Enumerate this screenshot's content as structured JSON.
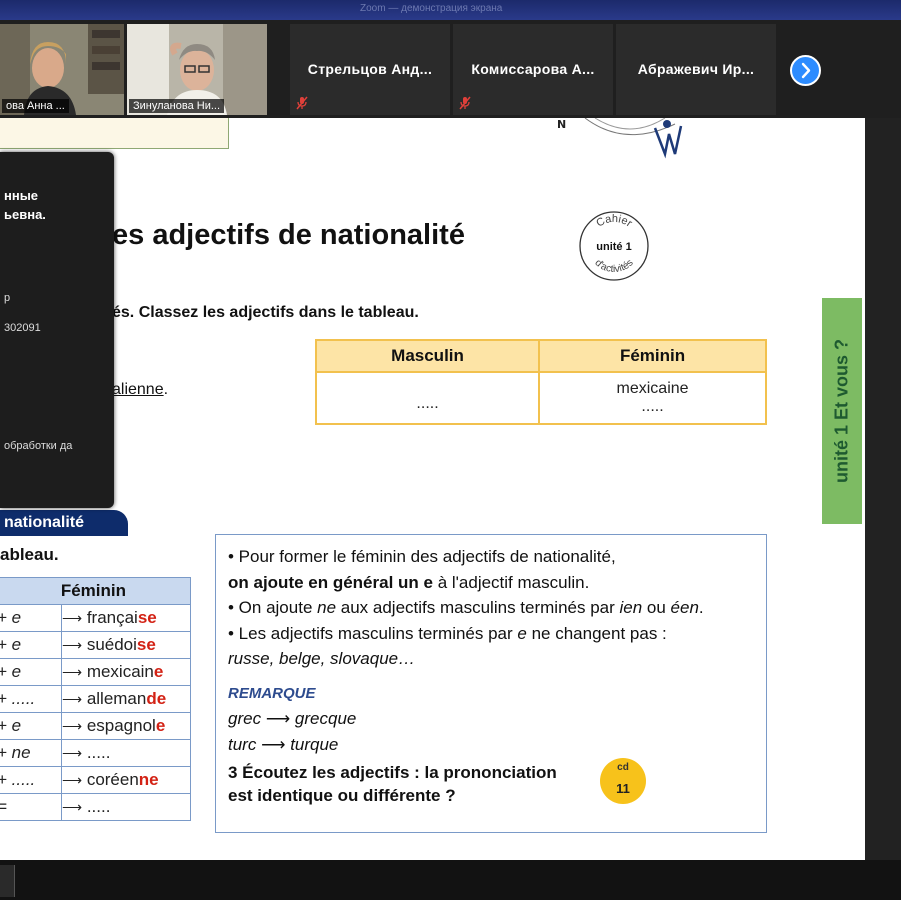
{
  "window": {
    "title": "Zoom — демонстрация экрана"
  },
  "participants": [
    {
      "label": "ова Анна ...",
      "type": "video",
      "active": true
    },
    {
      "label": "Зинуланова Ни...",
      "type": "video",
      "active": false
    },
    {
      "label": "Стрельцов Анд...",
      "type": "name",
      "muted": true
    },
    {
      "label": "Комиссарова А...",
      "type": "name",
      "muted": true
    },
    {
      "label": "Абражевич Ир...",
      "type": "name",
      "muted": false
    }
  ],
  "icons": {
    "next": "chevron-right-icon",
    "mic_off": "mic-off-icon"
  },
  "colors": {
    "zoom_blue": "#2d8cff",
    "active_outline": "#9fd03b",
    "table_orange": "#f2c14e",
    "banner_navy": "#0e2c6b",
    "highlight_red": "#d32215",
    "side_green": "#7dbb63"
  },
  "info_panel": {
    "name_line1": "нные",
    "name_line2": "ьевна.",
    "row1": "р",
    "row2": "302091",
    "row3": "обработки да"
  },
  "doc": {
    "heading": "es adjectifs de nationalité",
    "stamp": {
      "top": "Cahier",
      "mid": "unité 1",
      "bottom": "d'activités"
    },
    "instruction": "és. Classez les adjectifs dans le tableau.",
    "example_word": "alienne",
    "example_suffix": ".",
    "top_table": {
      "headers": [
        "Masculin",
        "Féminin"
      ],
      "cell_masc": ".....",
      "cell_fem_line1": "mexicaine",
      "cell_fem_line2": "....."
    },
    "side_tab": "unité 1  Et vous ?",
    "section_banner": "nationalité",
    "tableau_label": "ableau.",
    "fem_table": {
      "header": "Féminin",
      "rows": [
        {
          "op": "+ e",
          "base": "françai",
          "ending": "se"
        },
        {
          "op": "+ e",
          "base": "suédoi",
          "ending": "se"
        },
        {
          "op": "+ e",
          "base": "mexicain",
          "ending": "e"
        },
        {
          "op": "+ .....",
          "base": "alleman",
          "ending": "de"
        },
        {
          "op": "+ e",
          "base": "espagnol",
          "ending": "e"
        },
        {
          "op": "+ ne",
          "base": ".....",
          "ending": ""
        },
        {
          "op": "+ .....",
          "base": "coréen",
          "ending": "ne"
        },
        {
          "op": "=",
          "base": ".....",
          "ending": ""
        }
      ]
    },
    "rules": {
      "r1": "• Pour former le féminin des adjectifs de nationalité,",
      "r1b_bold": "on ajoute en général un e",
      "r1b_rest": " à l'adjectif masculin.",
      "r2_a": "• On ajoute ",
      "r2_ne": "ne",
      "r2_b": " aux adjectifs masculins terminés par ",
      "r2_ien": "ien",
      "r2_c": " ou ",
      "r2_een": "éen",
      "r2_d": ".",
      "r3_a": "• Les adjectifs masculins terminés par ",
      "r3_e": "e",
      "r3_b": " ne changent pas :",
      "r3_examples": "russe, belge, slovaque…",
      "remarque": "REMARQUE",
      "ex1_a": "grec",
      "ex1_b": "grecque",
      "ex2_a": "turc",
      "ex2_b": "turque",
      "ex3_line1": "3 Écoutez les adjectifs : la prononciation",
      "ex3_line2": "est identique ou différente ?"
    },
    "cd": {
      "top": "cd",
      "num": "11"
    }
  }
}
